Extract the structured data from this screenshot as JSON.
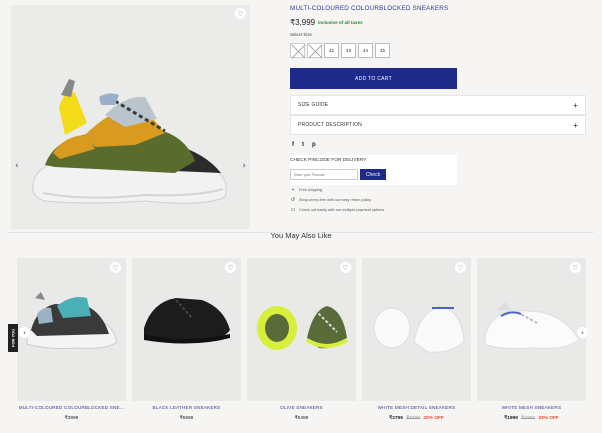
{
  "product": {
    "title": "MULTI-COLOURED COLOURBLOCKED SNEAKERS",
    "price": "₹3,999",
    "tax_note": "inclusive of all taxes",
    "select_size_label": "Select Size",
    "sizes": [
      {
        "label": "40",
        "available": false
      },
      {
        "label": "41",
        "available": false
      },
      {
        "label": "42",
        "available": true
      },
      {
        "label": "43",
        "available": true
      },
      {
        "label": "44",
        "available": true
      },
      {
        "label": "45",
        "available": true
      }
    ],
    "add_to_cart": "ADD TO CART",
    "accordion": [
      {
        "label": "SIZE GUIDE",
        "icon": "+"
      },
      {
        "label": "PRODUCT DESCRIPTION",
        "icon": "+"
      }
    ],
    "social": [
      "f",
      "t",
      "p"
    ],
    "pincode": {
      "label": "CHECK PINCODE FOR DELIVERY",
      "placeholder": "Enter your Pincode",
      "button": "Check"
    },
    "features": [
      {
        "icon": "truck-icon",
        "text": "Free shipping"
      },
      {
        "icon": "return-icon",
        "text": "Shop worry-free with our easy return policy"
      },
      {
        "icon": "card-icon",
        "text": "Check out easily with our multiple payment options"
      }
    ],
    "nav": {
      "prev": "‹",
      "next": "›",
      "wishlist": "♡"
    }
  },
  "recommendations": {
    "heading": "You May Also Like",
    "for_you_tab": "FOR YOU",
    "items": [
      {
        "name": "MULTI-COLOURED COLOURBLOCKED SNE...",
        "price": "₹3999",
        "old_price": "",
        "discount": ""
      },
      {
        "name": "BLACK LEATHER SNEAKERS",
        "price": "₹5999",
        "old_price": "",
        "discount": ""
      },
      {
        "name": "OLIVE SNEAKERS",
        "price": "₹5499",
        "old_price": "",
        "discount": ""
      },
      {
        "name": "WHITE MESH DETAIL SNEAKERS",
        "price": "₹2799",
        "old_price": "₹3499",
        "discount": "20% OFF"
      },
      {
        "name": "WHITE MESH SNEAKERS",
        "price": "₹1999",
        "old_price": "₹2999",
        "discount": "33% OFF"
      }
    ]
  },
  "colors": {
    "brand": "#1e2a8a",
    "tax_green": "#2a8a2a",
    "discount": "#e04a2a"
  }
}
